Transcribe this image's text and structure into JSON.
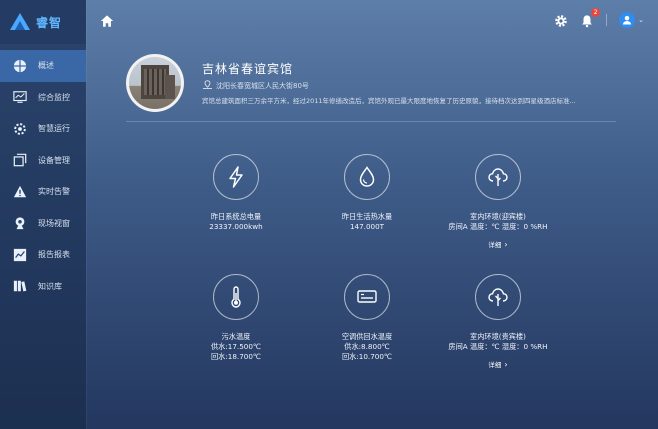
{
  "app": {
    "logo_text": "睿智"
  },
  "sidebar": {
    "items": [
      {
        "label": "概述",
        "icon": "globe-icon",
        "active": true
      },
      {
        "label": "综合监控",
        "icon": "monitor-icon",
        "active": false
      },
      {
        "label": "智慧运行",
        "icon": "settings-icon",
        "active": false
      },
      {
        "label": "设备管理",
        "icon": "copy-icon",
        "active": false
      },
      {
        "label": "实时告警",
        "icon": "warning-icon",
        "active": false
      },
      {
        "label": "现场视窗",
        "icon": "camera-icon",
        "active": false
      },
      {
        "label": "报告报表",
        "icon": "chart-icon",
        "active": false
      },
      {
        "label": "知识库",
        "icon": "books-icon",
        "active": false
      }
    ]
  },
  "topbar": {
    "notification_count": "2"
  },
  "hotel": {
    "name": "吉林省春谊宾馆",
    "address": "沈阳长春宽城区人民大街80号",
    "description": "宾馆总建筑面积三万余平方米，经过2011年修缮改造后，宾馆外观已最大限度地恢复了历史原貌，接待档次达到四星级酒店标准..."
  },
  "cards": [
    {
      "title": "昨日系统总电量",
      "lines": [
        "23337.000kwh"
      ],
      "icon": "lightning-icon"
    },
    {
      "title": "昨日生活热水量",
      "lines": [
        "147.000T"
      ],
      "icon": "water-drop-icon"
    },
    {
      "title": "室内环境(迎宾楼)",
      "lines": [
        "房间A 温度：℃ 湿度：0 %RH"
      ],
      "icon": "cloud-tree-icon",
      "detail": "详细"
    },
    {
      "title": "污水温度",
      "lines": [
        "供水:17.500℃",
        "回水:18.700℃"
      ],
      "icon": "thermometer-icon"
    },
    {
      "title": "空调供回水温度",
      "lines": [
        "供水:8.800℃",
        "回水:10.700℃"
      ],
      "icon": "air-conditioner-icon"
    },
    {
      "title": "室内环境(贵宾楼)",
      "lines": [
        "房间A 温度：℃ 湿度：0 %RH"
      ],
      "icon": "cloud-tree-icon",
      "detail": "详细"
    }
  ]
}
